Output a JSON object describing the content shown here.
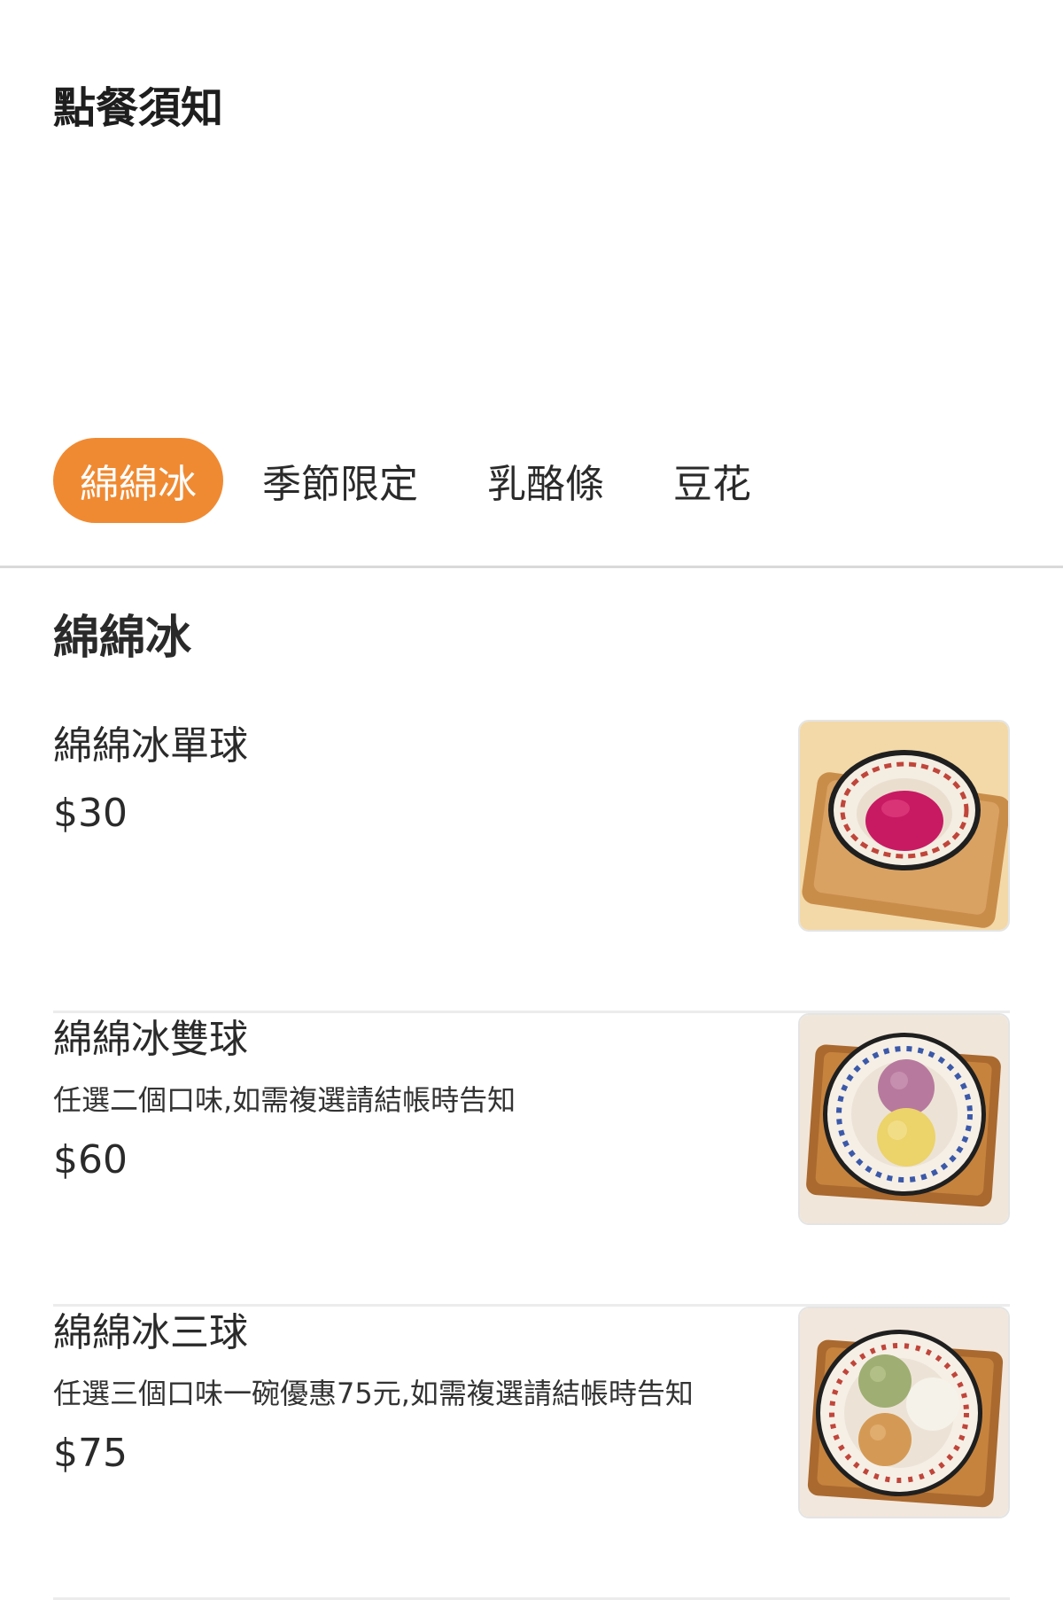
{
  "notice": {
    "title": "點餐須知"
  },
  "tabs": [
    {
      "label": "綿綿冰",
      "active": true
    },
    {
      "label": "季節限定",
      "active": false
    },
    {
      "label": "乳酪條",
      "active": false
    },
    {
      "label": "豆花",
      "active": false
    }
  ],
  "section": {
    "title": "綿綿冰"
  },
  "colors": {
    "accent": "#f08a32",
    "divider": "#d9d9d9"
  },
  "items": [
    {
      "name": "綿綿冰單球",
      "description": "",
      "price": "$30",
      "photo": "bowl-one-scoop-magenta"
    },
    {
      "name": "綿綿冰雙球",
      "description": "任選二個口味,如需複選請結帳時告知",
      "price": "$60",
      "photo": "bowl-two-scoops-purple-yellow"
    },
    {
      "name": "綿綿冰三球",
      "description": "任選三個口味一碗優惠75元,如需複選請結帳時告知",
      "price": "$75",
      "photo": "bowl-three-scoops-green-white-orange"
    }
  ]
}
